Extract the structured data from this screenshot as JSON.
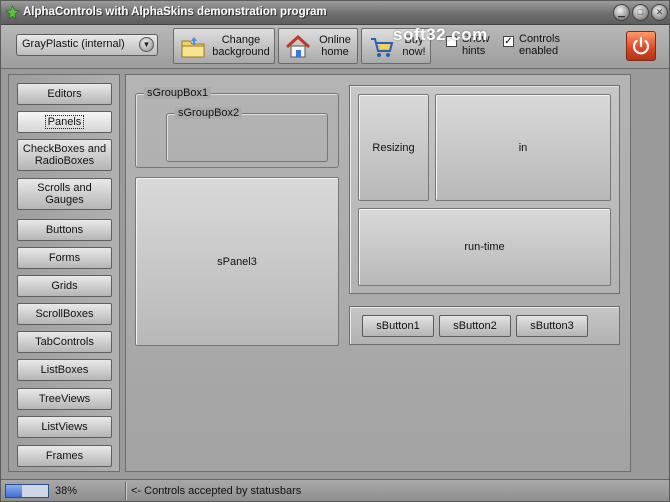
{
  "window": {
    "title": "AlphaControls with AlphaSkins demonstration program"
  },
  "toolbar": {
    "skin_select_value": "GrayPlastic (internal)",
    "change_background_label": "Change\nbackground",
    "online_home_label": "Online\nhome",
    "buy_now_label": "Buy\nnow!",
    "hints_label": "Show\nhints",
    "hints_checked": false,
    "controls_enabled_label": "Controls\nenabled",
    "controls_enabled_checked": true
  },
  "watermark": "soft32.com",
  "sidebar": {
    "items": [
      {
        "label": "Editors"
      },
      {
        "label": "Panels"
      },
      {
        "label": "CheckBoxes and\nRadioBoxes"
      },
      {
        "label": "Scrolls and\nGauges"
      },
      {
        "label": "Buttons"
      },
      {
        "label": "Forms"
      },
      {
        "label": "Grids"
      },
      {
        "label": "ScrollBoxes"
      },
      {
        "label": "TabControls"
      },
      {
        "label": "ListBoxes"
      },
      {
        "label": "TreeViews"
      },
      {
        "label": "ListViews"
      },
      {
        "label": "Frames"
      }
    ],
    "active_index": 1
  },
  "main": {
    "groupbox1_caption": "sGroupBox1",
    "groupbox2_caption": "sGroupBox2",
    "panel3_label": "sPanel3",
    "resize_panel_labels": {
      "resizing": "Resizing",
      "in": "in",
      "runtime": "run-time"
    },
    "buttons": [
      "sButton1",
      "sButton2",
      "sButton3"
    ]
  },
  "statusbar": {
    "progress_percent": 38,
    "progress_text": "38%",
    "message": "<- Controls accepted by statusbars"
  },
  "colors": {
    "accent_blue": "#3e6fd0",
    "power_red": "#e0492a"
  }
}
